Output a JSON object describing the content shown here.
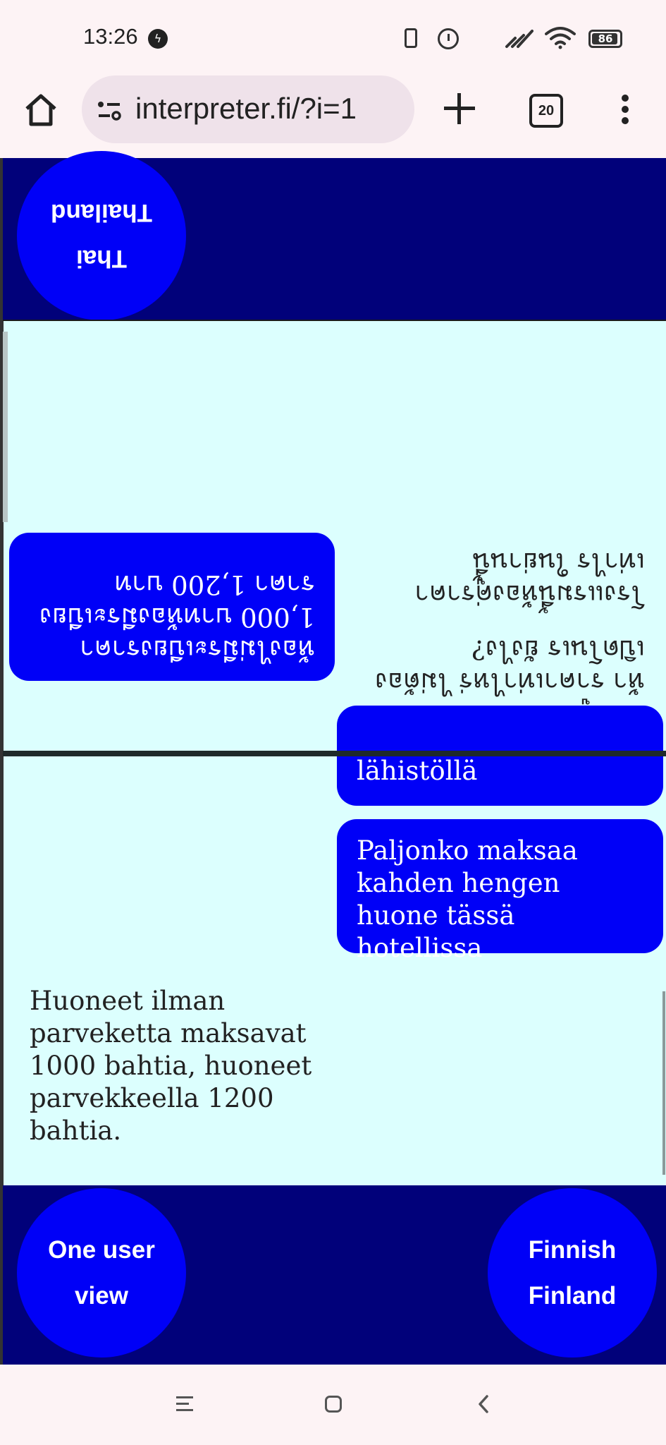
{
  "status_bar": {
    "time": "13:26",
    "battery": "86",
    "icons": [
      "messenger-icon",
      "vibrate-icon",
      "alarm-icon",
      "signal-icon",
      "wifi-icon",
      "battery-icon"
    ]
  },
  "browser": {
    "url": "interpreter.fi/?i=1",
    "tab_count": "20",
    "icons": [
      "home-icon",
      "site-settings-icon",
      "new-tab-icon",
      "tabs-icon",
      "more-icon"
    ]
  },
  "top_panel": {
    "language_button": {
      "line1": "Thai",
      "line2": "Thailand"
    }
  },
  "top_conversation": {
    "bubble": "ห้องไม่มีระเบียงราคา 1,000 บาทห้องมีระเบียง ราคา 1,200 บาท",
    "text_1": "แล้วคู่ไปแบบมีวงสอบในห้า ราคาเท่าไหร่ ไม่ต้องเปิดโนเร ยังไง?",
    "text_2": "โรงแรมนี้ห้องคู่ราคาเท่าไร ในย่านนี้"
  },
  "bottom_conversation": {
    "bubble_1": "lähistöllä",
    "bubble_2": "Paljonko maksaa kahden hengen huone tässä hotellissa",
    "answer": "Huoneet ilman parveketta maksavat 1000 bahtia, huoneet parvekkeella 1200 bahtia."
  },
  "bottom_panel": {
    "one_user_button": {
      "line1": "One user",
      "line2": "view"
    },
    "language_button": {
      "line1": "Finnish",
      "line2": "Finland"
    }
  },
  "nav_bar": {
    "icons": [
      "recents-icon",
      "home-nav-icon",
      "back-icon"
    ]
  },
  "colors": {
    "panel_bg": "#01017a",
    "button_blue": "#0000f7",
    "conversation_bg": "#dcfffe"
  }
}
